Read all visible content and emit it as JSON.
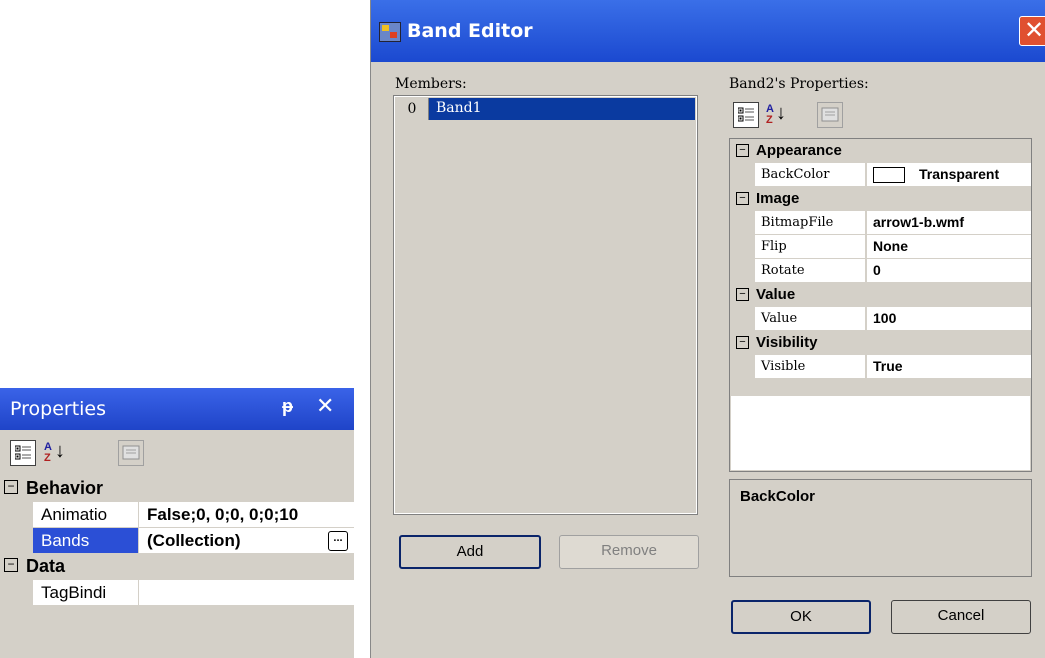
{
  "properties_panel": {
    "title": "Properties",
    "pin_glyph": "ᵽ",
    "close_glyph": "✕",
    "toolbar": {
      "sort_glyph": "↓",
      "az_top": "A",
      "az_bottom": "Z"
    },
    "categories": [
      {
        "label": "Behavior",
        "expander": "⊟",
        "rows": [
          {
            "name": "Animatio",
            "value": "False;0, 0;0, 0;0;10"
          },
          {
            "name": "Bands",
            "value": "(Collection)",
            "button": "..."
          }
        ]
      },
      {
        "label": "Data",
        "expander": "⊟",
        "rows": [
          {
            "name": "TagBindi",
            "value": ""
          }
        ]
      }
    ]
  },
  "band_editor": {
    "title": "Band Editor",
    "close_glyph": "✕",
    "members_label": "Members:",
    "members": [
      {
        "index": "0",
        "name": "Band1"
      }
    ],
    "add_label": "Add",
    "remove_label": "Remove",
    "props_label": "Band2's Properties:",
    "grid": {
      "appearance": {
        "label": "Appearance",
        "backcolor_name": "BackColor",
        "backcolor_value": "Transparent"
      },
      "image": {
        "label": "Image",
        "bitmap_name": "BitmapFile",
        "bitmap_value": "arrow1-b.wmf",
        "flip_name": "Flip",
        "flip_value": "None",
        "rotate_name": "Rotate",
        "rotate_value": "0"
      },
      "value": {
        "label": "Value",
        "value_name": "Value",
        "value_value": "100"
      },
      "visibility": {
        "label": "Visibility",
        "visible_name": "Visible",
        "visible_value": "True"
      },
      "expander": "⊟"
    },
    "description_title": "BackColor",
    "ok_label": "OK",
    "cancel_label": "Cancel"
  }
}
